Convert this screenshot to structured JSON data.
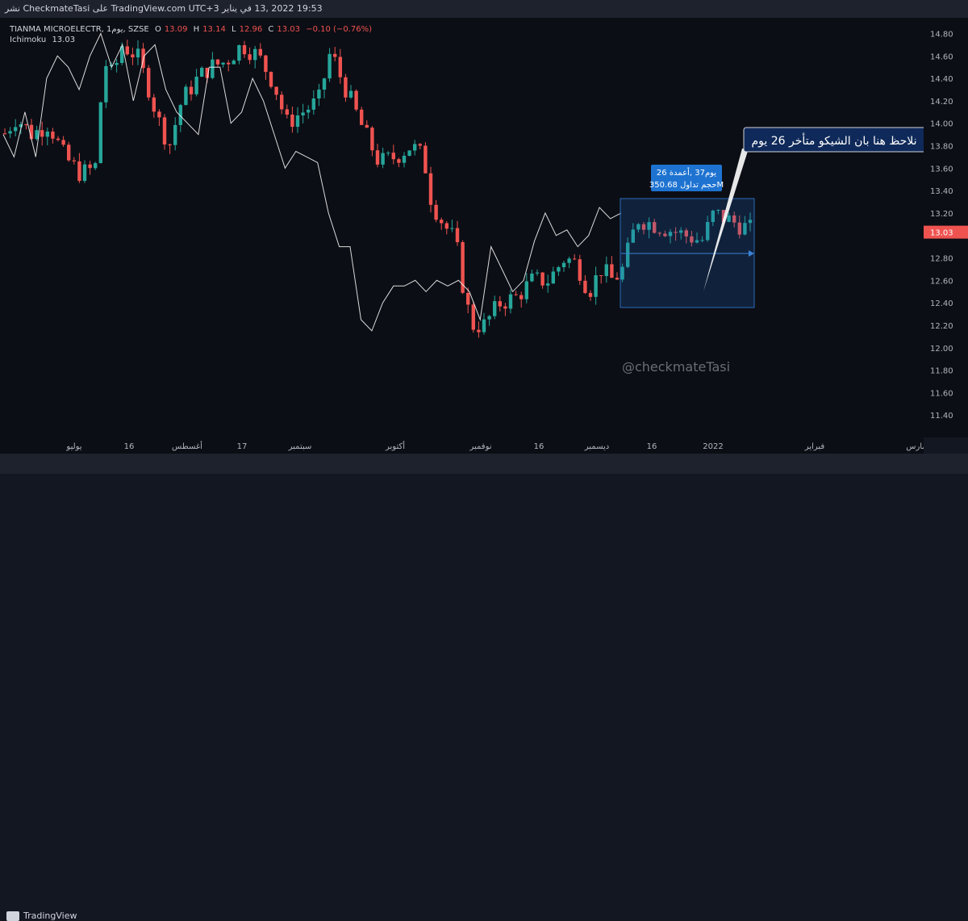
{
  "header": {
    "publish_line": "نشر CheckmateTasi على TradingView.com ‫19:53 2022 ,13 في يناير UTC+3"
  },
  "legend": {
    "symbol": "TIANMA MICROELECTR, 1يوم, SZSE",
    "o_label": "O",
    "o_value": "13.09",
    "h_label": "H",
    "h_value": "13.14",
    "l_label": "L",
    "l_value": "12.96",
    "c_label": "C",
    "c_value": "13.03",
    "change": "−0.10 (−0.76%)",
    "indicator": "Ichimoku",
    "indicator_value": "13.03"
  },
  "annotation": {
    "callout_text": "نلاحظ هنا بان الشيكو متأخر 26 يوم",
    "range_line1": "يوم37 ,أعمدة 26",
    "range_line2": "350.68 حجم تداولM"
  },
  "watermark": "@checkmateTasi",
  "footer": {
    "brand": "TradingView"
  },
  "colors": {
    "up": "#26a69a",
    "down": "#ef5350",
    "ichimoku_line": "#ffffff",
    "range_box": "#1e6fc2",
    "background": "#0c0e15"
  },
  "chart_data": {
    "type": "line",
    "title": "",
    "xlabel": "",
    "ylabel": "",
    "ylim": [
      11.2,
      14.94
    ],
    "y_ticks": [
      "14.80",
      "14.60",
      "14.40",
      "14.20",
      "14.00",
      "13.80",
      "13.60",
      "13.40",
      "13.20",
      "13.00",
      "12.80",
      "12.60",
      "12.40",
      "12.20",
      "12.00",
      "11.80",
      "11.60",
      "11.40"
    ],
    "x_ticks": [
      "يوليو",
      "16",
      "أغسطس",
      "17",
      "سبتمبر",
      "أكتوبر",
      "نوفمبر",
      "16",
      "ديسمبر",
      "16",
      "2022",
      "فبراير",
      "مارس"
    ],
    "last_price": "13.03",
    "series": [
      {
        "name": "Ichimoku",
        "values": [
          13.9,
          13.7,
          14.1,
          13.7,
          14.4,
          14.6,
          14.5,
          14.3,
          14.6,
          14.8,
          14.5,
          14.7,
          14.2,
          14.6,
          14.7,
          14.3,
          14.1,
          14.0,
          13.9,
          14.5,
          14.5,
          14.0,
          14.1,
          14.4,
          14.2,
          13.9,
          13.6,
          13.75,
          13.7,
          13.65,
          13.2,
          12.9,
          12.9,
          12.25,
          12.15,
          12.4,
          12.55,
          12.55,
          12.6,
          12.5,
          12.6,
          12.55,
          12.6,
          12.5,
          12.25,
          12.9,
          12.7,
          12.5,
          12.6,
          12.95,
          13.2,
          13.0,
          13.05,
          12.9,
          13.0,
          13.25,
          13.15,
          13.2
        ]
      }
    ]
  }
}
